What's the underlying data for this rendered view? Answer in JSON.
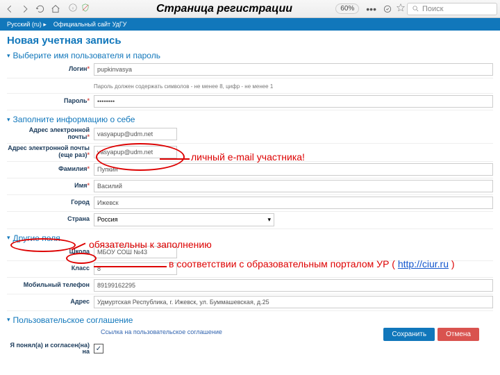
{
  "browser": {
    "zoom": "60%",
    "search_placeholder": "Поиск"
  },
  "bluebar": {
    "lang": "Русский (ru) ▸",
    "site": "Официальный сайт УдГУ"
  },
  "page_title": "Новая учетная запись",
  "section1": "Выберите имя пользователя и пароль",
  "section2": "Заполните информацию о себе",
  "section3": "Другие поля",
  "section4": "Пользовательское соглашение",
  "fields": {
    "login_label": "Логин",
    "login_value": "pupkinvasya",
    "password_label": "Пароль",
    "password_hint": "Пароль должен содержать символов - не менее 8, цифр - не менее 1",
    "password_value": "••••••••",
    "email_label": "Адрес электронной почты",
    "email_value": "vasyapup@udm.net",
    "email2_label": "Адрес электронной почты (еще раз)",
    "email2_value": "vasyapup@udm.net",
    "lastname_label": "Фамилия",
    "lastname_value": "Пупкин",
    "firstname_label": "Имя",
    "firstname_value": "Василий",
    "city_label": "Город",
    "city_value": "Ижевск",
    "country_label": "Страна",
    "country_value": "Россия",
    "school_label": "Школа",
    "school_value": "МБОУ СОШ №43",
    "grade_label": "Класс",
    "grade_value": "8",
    "phone_label": "Мобильный телефон",
    "phone_value": "89199162295",
    "address_label": "Адрес",
    "address_value": "Удмуртская Республика, г. Ижевск, ул. Буммашевская, д.25",
    "agreement_link": "Ссылка на пользовательское соглашение",
    "agree_label": "Я понял(а) и согласен(на) на"
  },
  "buttons": {
    "save": "Сохранить",
    "cancel": "Отмена"
  },
  "annotations": {
    "title": "Страница регистрации",
    "email_note": "личный e-mail участника!",
    "required_note": "обязательны к заполнению",
    "school_note_pre": "в соответствии с образовательным порталом УР ( ",
    "school_note_link": "http://ciur.ru",
    "school_note_post": " )"
  }
}
